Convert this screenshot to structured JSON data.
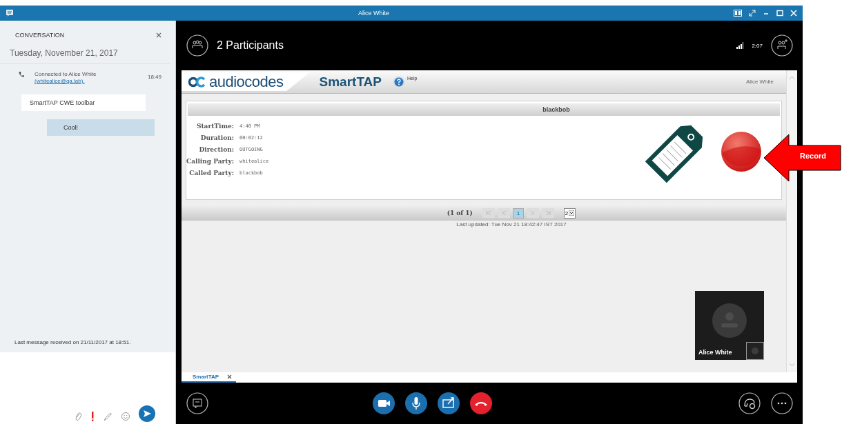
{
  "window": {
    "title": "Alice White"
  },
  "conversation": {
    "heading": "CONVERSATION",
    "date": "Tuesday, November 21, 2017",
    "event": {
      "text": "Connected to Alice White",
      "link": "(whitealice@qa.lab).",
      "time": "18:49"
    },
    "messages": [
      {
        "text": "SmartTAP CWE toolbar",
        "kind": "sent"
      },
      {
        "text": "Cool!",
        "kind": "received"
      }
    ],
    "status": "Last message received on 21/11/2017 at 18:51."
  },
  "call": {
    "participants": "2 Participants",
    "duration": "2:07"
  },
  "smarttap": {
    "brand": "audiocodes",
    "product": "SmartTAP",
    "help": "Help",
    "user": "Alice White",
    "record_title": "blackbob",
    "fields": [
      {
        "label": "StartTime:",
        "value": "4:40 PM"
      },
      {
        "label": "Duration:",
        "value": "00:02:12"
      },
      {
        "label": "Direction:",
        "value": "OUTGOING"
      },
      {
        "label": "Calling Party:",
        "value": "whitealice"
      },
      {
        "label": "Called Party:",
        "value": "blackbob"
      }
    ],
    "pager": {
      "summary": "(1 of 1)",
      "pages": [
        {
          "label": "1",
          "selected": true
        }
      ],
      "page_size": "2"
    },
    "updated": "Last updated: Tue Nov 21 18:42:47 IST 2017"
  },
  "video": {
    "name": "Alice White"
  },
  "browser_tabs": [
    {
      "label": "SmartTAP",
      "selected": true
    }
  ],
  "annotation": {
    "label": "Record"
  }
}
